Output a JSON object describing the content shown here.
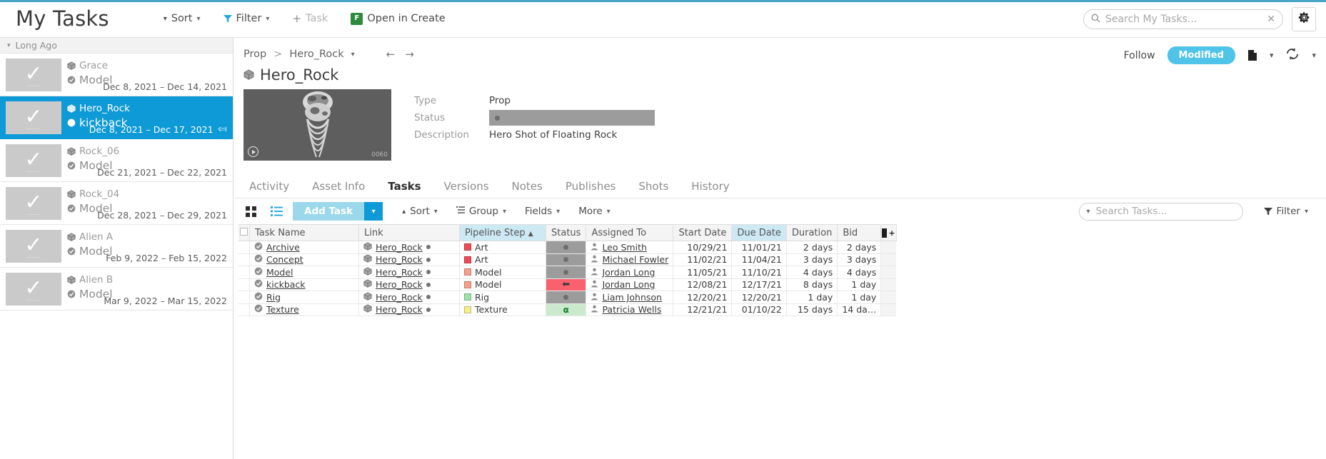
{
  "topbar": {
    "title": "My Tasks",
    "sort_label": "Sort",
    "filter_label": "Filter",
    "task_label": "Task",
    "open_in_create_label": "Open in Create",
    "create_icon_letter": "F",
    "search_placeholder": "Search My Tasks...",
    "accent_color": "#4aa5c8"
  },
  "sidebar": {
    "group_label": "Long Ago",
    "items": [
      {
        "asset": "Grace",
        "task": "Model",
        "dates": "Dec 8, 2021 – Dec 14, 2021 ",
        "selected": false,
        "has_arrow": false
      },
      {
        "asset": "Hero_Rock",
        "task": "kickback",
        "dates": "Dec 8, 2021 – Dec 17, 2021",
        "selected": true,
        "has_arrow": true
      },
      {
        "asset": "Rock_06",
        "task": "Model",
        "dates": "Dec 21, 2021 – Dec 22, 2021 ",
        "selected": false,
        "has_arrow": false
      },
      {
        "asset": "Rock_04",
        "task": "Model",
        "dates": "Dec 28, 2021 – Dec 29, 2021 ",
        "selected": false,
        "has_arrow": false
      },
      {
        "asset": "Alien A",
        "task": "Model",
        "dates": "Feb 9, 2022 – Feb 15, 2022 ",
        "selected": false,
        "has_arrow": false
      },
      {
        "asset": "Alien B",
        "task": "Model",
        "dates": "Mar 9, 2022 – Mar 15, 2022 ",
        "selected": false,
        "has_arrow": false
      }
    ]
  },
  "detail": {
    "breadcrumb": {
      "parent": "Prop",
      "separator": ">",
      "current": "Hero_Rock"
    },
    "follow_label": "Follow",
    "status_pill": "Modified",
    "status_pill_color": "#4fc3e8",
    "asset_title": "Hero_Rock",
    "preview_frame": "0060",
    "fields": [
      {
        "label": "Type",
        "value": "Prop"
      },
      {
        "label": "Status",
        "value": ""
      },
      {
        "label": "Description",
        "value": "Hero Shot of Floating Rock"
      }
    ],
    "tabs": [
      {
        "label": "Activity",
        "active": false
      },
      {
        "label": "Asset Info",
        "active": false
      },
      {
        "label": "Tasks",
        "active": true
      },
      {
        "label": "Versions",
        "active": false
      },
      {
        "label": "Notes",
        "active": false
      },
      {
        "label": "Publishes",
        "active": false
      },
      {
        "label": "Shots",
        "active": false
      },
      {
        "label": "History",
        "active": false
      }
    ]
  },
  "tasks_toolbar": {
    "add_task_label": "Add Task",
    "sort_label": "Sort",
    "group_label": "Group",
    "fields_label": "Fields",
    "more_label": "More",
    "search_placeholder": "Search Tasks...",
    "filter_label": "Filter"
  },
  "table": {
    "columns": [
      {
        "key": "task_name",
        "label": "Task Name",
        "sorted": false,
        "align": "left"
      },
      {
        "key": "link",
        "label": "Link",
        "sorted": false,
        "align": "left"
      },
      {
        "key": "pipeline_step",
        "label": "Pipeline Step",
        "sorted": true,
        "align": "left"
      },
      {
        "key": "status",
        "label": "Status",
        "sorted": false,
        "align": "left"
      },
      {
        "key": "assigned_to",
        "label": "Assigned To",
        "sorted": false,
        "align": "left"
      },
      {
        "key": "start_date",
        "label": "Start Date",
        "sorted": false,
        "align": "right"
      },
      {
        "key": "due_date",
        "label": "Due Date",
        "sorted": true,
        "align": "right"
      },
      {
        "key": "duration",
        "label": "Duration",
        "sorted": false,
        "align": "right"
      },
      {
        "key": "bid",
        "label": "Bid",
        "sorted": false,
        "align": "right"
      }
    ],
    "sort_indicator": "▲",
    "rows": [
      {
        "task_name": "Archive",
        "link": "Hero_Rock",
        "pipeline_step": "Art",
        "pipeline_color": "#ef4a57",
        "status_type": "dot",
        "status_bg": "#9c9c9c",
        "assigned_to": "Leo Smith",
        "start_date": "10/29/21",
        "due_date": "11/01/21",
        "duration": "2 days",
        "bid": "2 days"
      },
      {
        "task_name": "Concept",
        "link": "Hero_Rock",
        "pipeline_step": "Art",
        "pipeline_color": "#ef4a57",
        "status_type": "dot",
        "status_bg": "#9c9c9c",
        "assigned_to": "Michael Fowler",
        "start_date": "11/02/21",
        "due_date": "11/04/21",
        "duration": "3 days",
        "bid": "3 days"
      },
      {
        "task_name": "Model",
        "link": "Hero_Rock",
        "pipeline_step": "Model",
        "pipeline_color": "#f6a08a",
        "status_type": "dot",
        "status_bg": "#9c9c9c",
        "assigned_to": "Jordan Long",
        "start_date": "11/05/21",
        "due_date": "11/10/21",
        "duration": "4 days",
        "bid": "4 days"
      },
      {
        "task_name": "kickback",
        "link": "Hero_Rock",
        "pipeline_step": "Model",
        "pipeline_color": "#f6a08a",
        "status_type": "arrow",
        "status_bg": "#f9616f",
        "assigned_to": "Jordan Long",
        "start_date": "12/08/21",
        "due_date": "12/17/21",
        "duration": "8 days",
        "bid": "1 day"
      },
      {
        "task_name": "Rig",
        "link": "Hero_Rock",
        "pipeline_step": "Rig",
        "pipeline_color": "#9ce2a8",
        "status_type": "dot",
        "status_bg": "#9c9c9c",
        "assigned_to": "Liam Johnson",
        "start_date": "12/20/21",
        "due_date": "12/20/21",
        "duration": "1 day",
        "bid": "1 day"
      },
      {
        "task_name": "Texture",
        "link": "Hero_Rock",
        "pipeline_step": "Texture",
        "pipeline_color": "#f5ef8a",
        "status_type": "omega",
        "status_bg": "#cbe9cc",
        "assigned_to": "Patricia Wells",
        "start_date": "12/21/21",
        "due_date": "01/10/22",
        "duration": "15 days",
        "bid": "14 da…"
      }
    ]
  }
}
